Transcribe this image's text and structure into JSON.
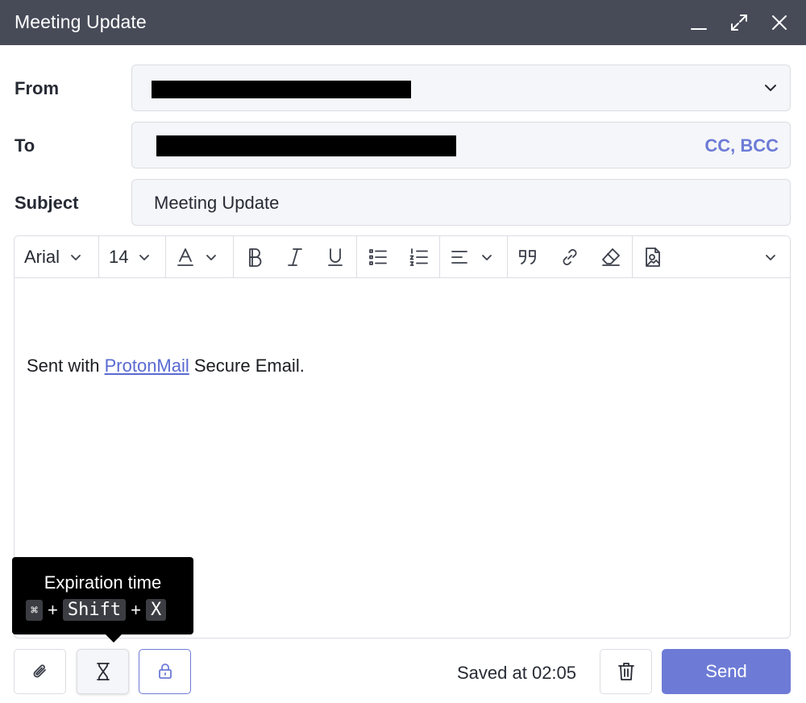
{
  "window": {
    "title": "Meeting Update",
    "controls": [
      "minimize-icon",
      "maximize-icon",
      "close-icon"
    ]
  },
  "from": {
    "label": "From"
  },
  "to": {
    "label": "To",
    "cc_bcc": "CC, BCC"
  },
  "subject": {
    "label": "Subject",
    "value": "Meeting Update"
  },
  "toolbar": {
    "font_family": "Arial",
    "font_size": "14",
    "icons": [
      "text-color-icon",
      "bold-icon",
      "italic-icon",
      "underline-icon",
      "bullet-list-icon",
      "numbered-list-icon",
      "align-icon",
      "quote-icon",
      "link-icon",
      "clear-format-icon",
      "insert-image-icon",
      "more-icon"
    ]
  },
  "body": {
    "prefix": "Sent with ",
    "link_text": "ProtonMail",
    "suffix": " Secure Email."
  },
  "tooltip": {
    "title": "Expiration time",
    "key_cmd": "⌘",
    "plus": "+",
    "key_shift": "Shift",
    "key_x": "X"
  },
  "footer": {
    "saved_text": "Saved at 02:05",
    "send_label": "Send",
    "accent_color": "#6d7bd6"
  }
}
